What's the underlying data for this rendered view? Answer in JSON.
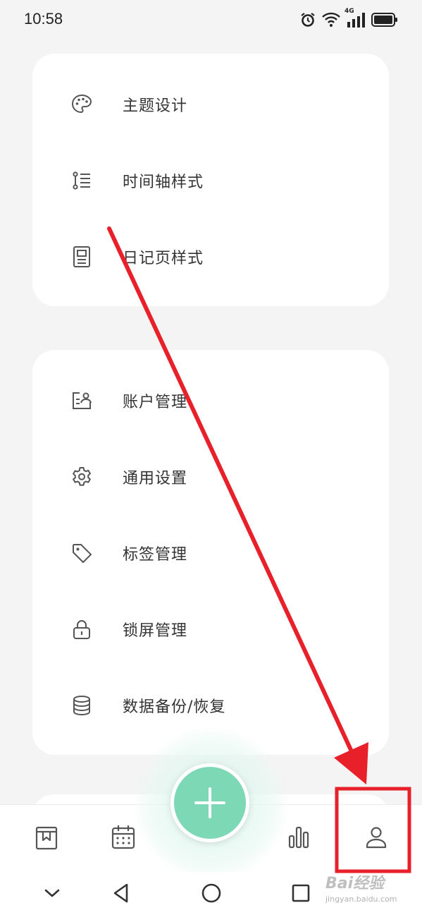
{
  "status_bar": {
    "time": "10:58",
    "network": "4G"
  },
  "menu_groups": [
    {
      "items": [
        {
          "label": "主题设计",
          "icon": "palette-icon"
        },
        {
          "label": "时间轴样式",
          "icon": "timeline-list-icon"
        },
        {
          "label": "日记页样式",
          "icon": "diary-page-icon"
        }
      ]
    },
    {
      "items": [
        {
          "label": "账户管理",
          "icon": "account-card-icon"
        },
        {
          "label": "通用设置",
          "icon": "gear-icon"
        },
        {
          "label": "标签管理",
          "icon": "tag-icon"
        },
        {
          "label": "锁屏管理",
          "icon": "lock-icon"
        },
        {
          "label": "数据备份/恢复",
          "icon": "database-icon"
        }
      ]
    }
  ],
  "tab_bar": {
    "items": [
      "diary-book-icon",
      "calendar-icon",
      "bar-chart-icon",
      "person-icon"
    ],
    "selected": "person-icon"
  },
  "fab_icon": "plus-icon",
  "nav_bar": [
    "chevron-down-icon",
    "back-triangle-icon",
    "home-circle-icon",
    "recents-square-icon"
  ],
  "annotation": {
    "color": "#e8202a"
  },
  "watermark": {
    "logo": "Bai经验",
    "url": "jingyan.baidu.com"
  },
  "colors": {
    "accent": "#7dd8b5",
    "card": "#ffffff",
    "background": "#f4f4f4",
    "icon": "#555555"
  }
}
